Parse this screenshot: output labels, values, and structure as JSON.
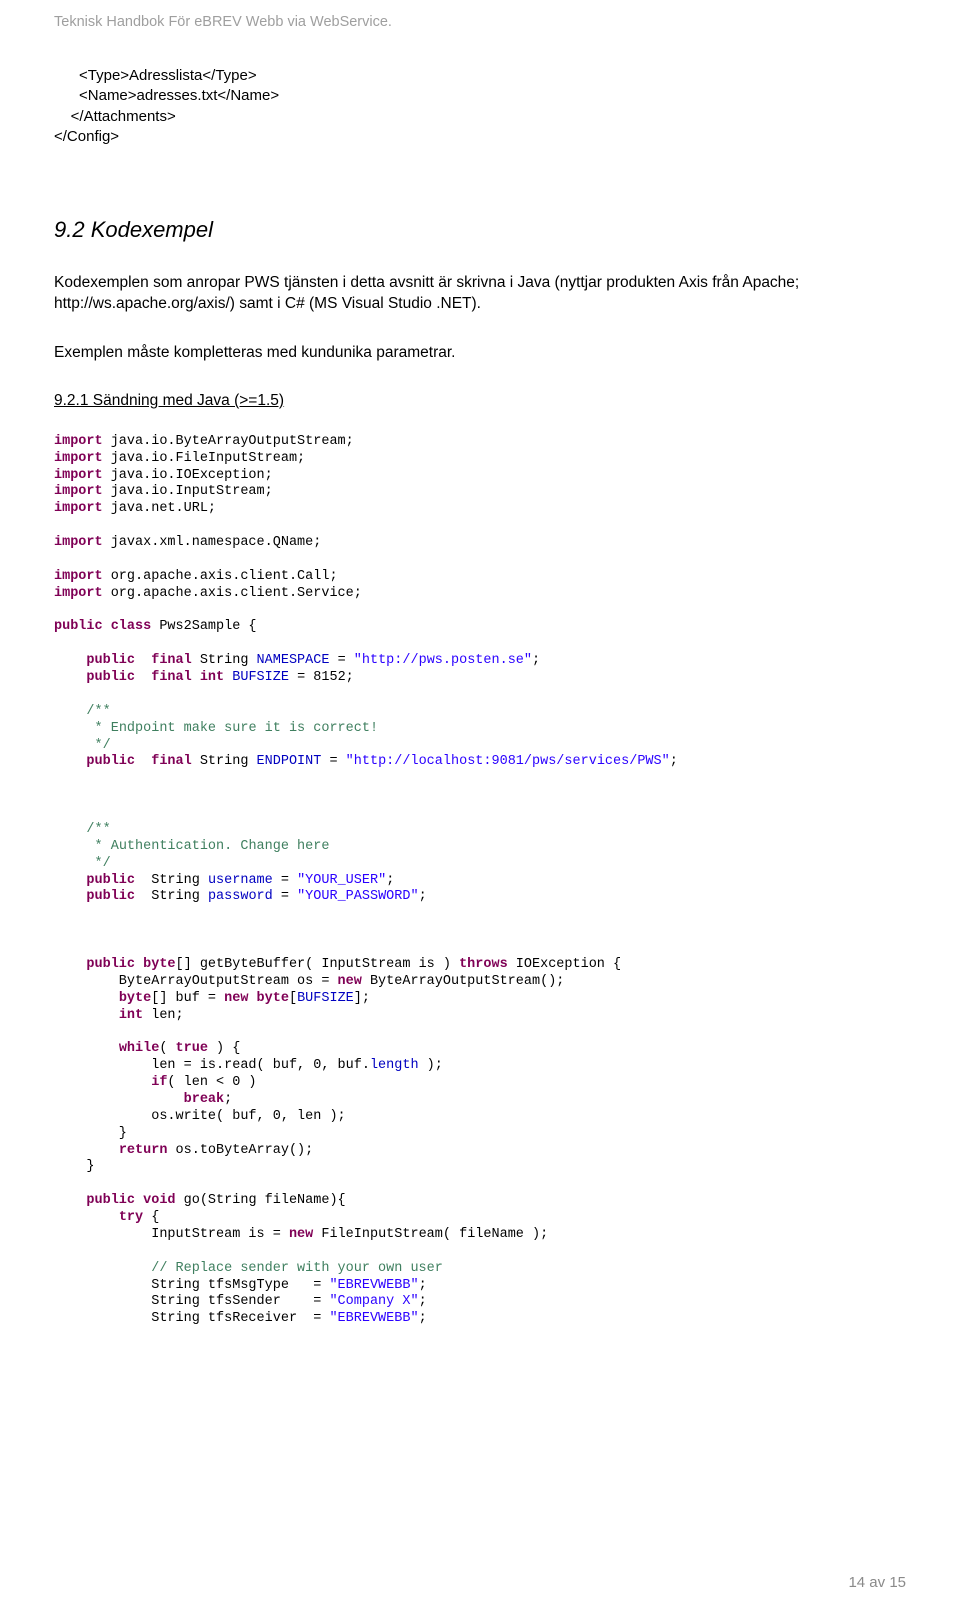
{
  "running_header": "Teknisk Handbok För eBREV Webb via WebService.",
  "xml_snippet": "      <Type>Adresslista</Type>\n      <Name>adresses.txt</Name>\n    </Attachments>\n</Config>",
  "section_9_2_title": "9.2 Kodexempel",
  "section_9_2_body": "Kodexemplen som anropar PWS tjänsten i detta avsnitt är skrivna i Java (nyttjar produkten Axis från Apache; http://ws.apache.org/axis/) samt i C# (MS Visual Studio .NET).",
  "section_9_2_body2": "Exemplen måste kompletteras med kundunika parametrar.",
  "section_9_2_1_title": "9.2.1 Sändning med Java (>=1.5)",
  "code_tokens": [
    {
      "t": "kw",
      "v": "import"
    },
    {
      "t": "tx",
      "v": " java.io.ByteArrayOutputStream;\n"
    },
    {
      "t": "kw",
      "v": "import"
    },
    {
      "t": "tx",
      "v": " java.io.FileInputStream;\n"
    },
    {
      "t": "kw",
      "v": "import"
    },
    {
      "t": "tx",
      "v": " java.io.IOException;\n"
    },
    {
      "t": "kw",
      "v": "import"
    },
    {
      "t": "tx",
      "v": " java.io.InputStream;\n"
    },
    {
      "t": "kw",
      "v": "import"
    },
    {
      "t": "tx",
      "v": " java.net.URL;\n\n"
    },
    {
      "t": "kw",
      "v": "import"
    },
    {
      "t": "tx",
      "v": " javax.xml.namespace.QName;\n\n"
    },
    {
      "t": "kw",
      "v": "import"
    },
    {
      "t": "tx",
      "v": " org.apache.axis.client.Call;\n"
    },
    {
      "t": "kw",
      "v": "import"
    },
    {
      "t": "tx",
      "v": " org.apache.axis.client.Service;\n\n"
    },
    {
      "t": "kw",
      "v": "public class"
    },
    {
      "t": "tx",
      "v": " Pws2Sample {\n\n"
    },
    {
      "t": "tx",
      "v": "    "
    },
    {
      "t": "kw",
      "v": "public  final"
    },
    {
      "t": "tx",
      "v": " String "
    },
    {
      "t": "var",
      "v": "NAMESPACE"
    },
    {
      "t": "tx",
      "v": " = "
    },
    {
      "t": "str",
      "v": "\"http://pws.posten.se\""
    },
    {
      "t": "tx",
      "v": ";\n"
    },
    {
      "t": "tx",
      "v": "    "
    },
    {
      "t": "kw",
      "v": "public  final int"
    },
    {
      "t": "tx",
      "v": " "
    },
    {
      "t": "var",
      "v": "BUFSIZE"
    },
    {
      "t": "tx",
      "v": " = 8152;\n\n"
    },
    {
      "t": "tx",
      "v": "    "
    },
    {
      "t": "cm",
      "v": "/**"
    },
    {
      "t": "tx",
      "v": "\n"
    },
    {
      "t": "tx",
      "v": "     "
    },
    {
      "t": "cm",
      "v": "* Endpoint make sure it is correct!"
    },
    {
      "t": "tx",
      "v": "\n"
    },
    {
      "t": "tx",
      "v": "     "
    },
    {
      "t": "cm",
      "v": "*/"
    },
    {
      "t": "tx",
      "v": "\n"
    },
    {
      "t": "tx",
      "v": "    "
    },
    {
      "t": "kw",
      "v": "public  final"
    },
    {
      "t": "tx",
      "v": " String "
    },
    {
      "t": "var",
      "v": "ENDPOINT"
    },
    {
      "t": "tx",
      "v": " = "
    },
    {
      "t": "str",
      "v": "\"http://localhost:9081/pws/services/PWS\""
    },
    {
      "t": "tx",
      "v": ";\n\n\n\n"
    },
    {
      "t": "tx",
      "v": "    "
    },
    {
      "t": "cm",
      "v": "/**"
    },
    {
      "t": "tx",
      "v": "\n"
    },
    {
      "t": "tx",
      "v": "     "
    },
    {
      "t": "cm",
      "v": "* Authentication. Change here"
    },
    {
      "t": "tx",
      "v": "\n"
    },
    {
      "t": "tx",
      "v": "     "
    },
    {
      "t": "cm",
      "v": "*/"
    },
    {
      "t": "tx",
      "v": "\n"
    },
    {
      "t": "tx",
      "v": "    "
    },
    {
      "t": "kw",
      "v": "public"
    },
    {
      "t": "tx",
      "v": "  String "
    },
    {
      "t": "var",
      "v": "username"
    },
    {
      "t": "tx",
      "v": " = "
    },
    {
      "t": "str",
      "v": "\"YOUR_USER\""
    },
    {
      "t": "tx",
      "v": ";\n"
    },
    {
      "t": "tx",
      "v": "    "
    },
    {
      "t": "kw",
      "v": "public"
    },
    {
      "t": "tx",
      "v": "  String "
    },
    {
      "t": "var",
      "v": "password"
    },
    {
      "t": "tx",
      "v": " = "
    },
    {
      "t": "str",
      "v": "\"YOUR_PASSWORD\""
    },
    {
      "t": "tx",
      "v": ";\n\n\n\n"
    },
    {
      "t": "tx",
      "v": "    "
    },
    {
      "t": "kw",
      "v": "public byte"
    },
    {
      "t": "tx",
      "v": "[] getByteBuffer( InputStream is ) "
    },
    {
      "t": "kw",
      "v": "throws"
    },
    {
      "t": "tx",
      "v": " IOException {\n"
    },
    {
      "t": "tx",
      "v": "        ByteArrayOutputStream os = "
    },
    {
      "t": "kw",
      "v": "new"
    },
    {
      "t": "tx",
      "v": " ByteArrayOutputStream();\n"
    },
    {
      "t": "tx",
      "v": "        "
    },
    {
      "t": "kw",
      "v": "byte"
    },
    {
      "t": "tx",
      "v": "[] buf = "
    },
    {
      "t": "kw",
      "v": "new byte"
    },
    {
      "t": "tx",
      "v": "["
    },
    {
      "t": "var",
      "v": "BUFSIZE"
    },
    {
      "t": "tx",
      "v": "];\n"
    },
    {
      "t": "tx",
      "v": "        "
    },
    {
      "t": "kw",
      "v": "int"
    },
    {
      "t": "tx",
      "v": " len;\n\n"
    },
    {
      "t": "tx",
      "v": "        "
    },
    {
      "t": "kw",
      "v": "while"
    },
    {
      "t": "tx",
      "v": "( "
    },
    {
      "t": "kw",
      "v": "true"
    },
    {
      "t": "tx",
      "v": " ) {\n"
    },
    {
      "t": "tx",
      "v": "            len = is.read( buf, 0, buf."
    },
    {
      "t": "var",
      "v": "length"
    },
    {
      "t": "tx",
      "v": " );\n"
    },
    {
      "t": "tx",
      "v": "            "
    },
    {
      "t": "kw",
      "v": "if"
    },
    {
      "t": "tx",
      "v": "( len < 0 )\n"
    },
    {
      "t": "tx",
      "v": "                "
    },
    {
      "t": "kw",
      "v": "break"
    },
    {
      "t": "tx",
      "v": ";\n"
    },
    {
      "t": "tx",
      "v": "            os.write( buf, 0, len );\n"
    },
    {
      "t": "tx",
      "v": "        }\n"
    },
    {
      "t": "tx",
      "v": "        "
    },
    {
      "t": "kw",
      "v": "return"
    },
    {
      "t": "tx",
      "v": " os.toByteArray();\n"
    },
    {
      "t": "tx",
      "v": "    }\n\n"
    },
    {
      "t": "tx",
      "v": "    "
    },
    {
      "t": "kw",
      "v": "public void"
    },
    {
      "t": "tx",
      "v": " go(String fileName){\n"
    },
    {
      "t": "tx",
      "v": "        "
    },
    {
      "t": "kw",
      "v": "try"
    },
    {
      "t": "tx",
      "v": " {\n"
    },
    {
      "t": "tx",
      "v": "            InputStream is = "
    },
    {
      "t": "kw",
      "v": "new"
    },
    {
      "t": "tx",
      "v": " FileInputStream( fileName );\n\n"
    },
    {
      "t": "tx",
      "v": "            "
    },
    {
      "t": "cm",
      "v": "// Replace sender with your own user"
    },
    {
      "t": "tx",
      "v": "\n"
    },
    {
      "t": "tx",
      "v": "            String tfsMsgType   = "
    },
    {
      "t": "str",
      "v": "\"EBREVWEBB\""
    },
    {
      "t": "tx",
      "v": ";\n"
    },
    {
      "t": "tx",
      "v": "            String tfsSender    = "
    },
    {
      "t": "str",
      "v": "\"Company X\""
    },
    {
      "t": "tx",
      "v": ";\n"
    },
    {
      "t": "tx",
      "v": "            String tfsReceiver  = "
    },
    {
      "t": "str",
      "v": "\"EBREVWEBB\""
    },
    {
      "t": "tx",
      "v": ";\n"
    }
  ],
  "footer": "14 av 15"
}
